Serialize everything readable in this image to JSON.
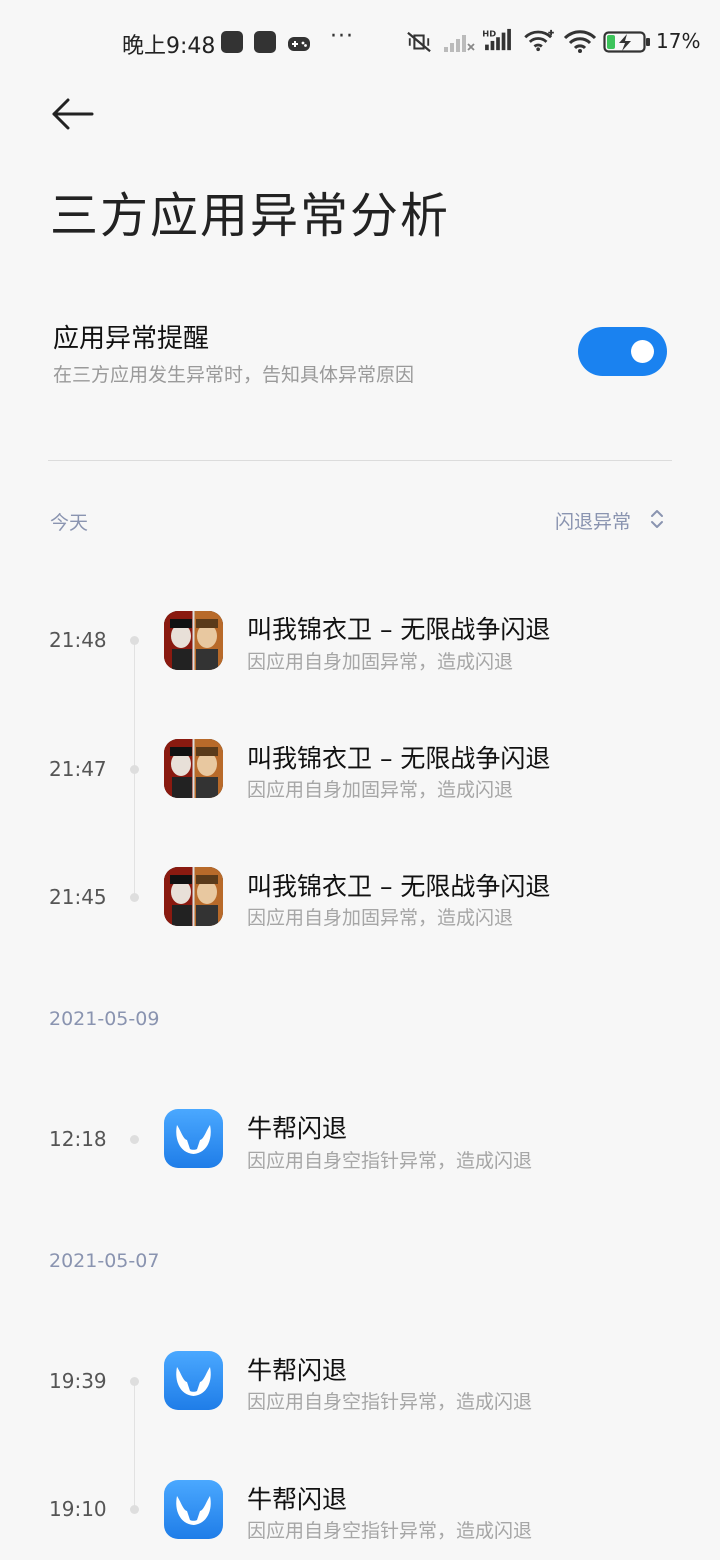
{
  "status_bar": {
    "time": "晚上9:48",
    "battery_percent": "17%",
    "icons": [
      "mi-notification-icon",
      "square-app-icon",
      "gamepad-icon",
      "more-dots-icon",
      "mute-vibrate-icon",
      "signal-weak-icon",
      "hd-signal-icon",
      "wifi-icon",
      "wifi-icon",
      "battery-charging-icon"
    ],
    "dots": "···"
  },
  "header": {
    "back_icon": "back-arrow-icon",
    "title": "三方应用异常分析"
  },
  "setting": {
    "title": "应用异常提醒",
    "subtitle": "在三方应用发生异常时，告知具体异常原因",
    "toggle_on": true,
    "accent": "#1a82f0"
  },
  "filter": {
    "today_label": "今天",
    "type_label": "闪退异常",
    "icon": "updown-chevron-icon"
  },
  "groups": [
    {
      "date": "今天",
      "records": [
        {
          "time": "21:48",
          "title": "叫我锦衣卫 – 无限战争闪退",
          "reason": "因应用自身加固异常，造成闪退",
          "icon": "game-app-icon"
        },
        {
          "time": "21:47",
          "title": "叫我锦衣卫 – 无限战争闪退",
          "reason": "因应用自身加固异常，造成闪退",
          "icon": "game-app-icon"
        },
        {
          "time": "21:45",
          "title": "叫我锦衣卫 – 无限战争闪退",
          "reason": "因应用自身加固异常，造成闪退",
          "icon": "game-app-icon"
        }
      ]
    },
    {
      "date": "2021-05-09",
      "records": [
        {
          "time": "12:18",
          "title": "牛帮闪退",
          "reason": "因应用自身空指针异常，造成闪退",
          "icon": "niubang-app-icon"
        }
      ]
    },
    {
      "date": "2021-05-07",
      "records": [
        {
          "time": "19:39",
          "title": "牛帮闪退",
          "reason": "因应用自身空指针异常，造成闪退",
          "icon": "niubang-app-icon"
        },
        {
          "time": "19:10",
          "title": "牛帮闪退",
          "reason": "因应用自身空指针异常，造成闪退",
          "icon": "niubang-app-icon"
        }
      ]
    }
  ]
}
